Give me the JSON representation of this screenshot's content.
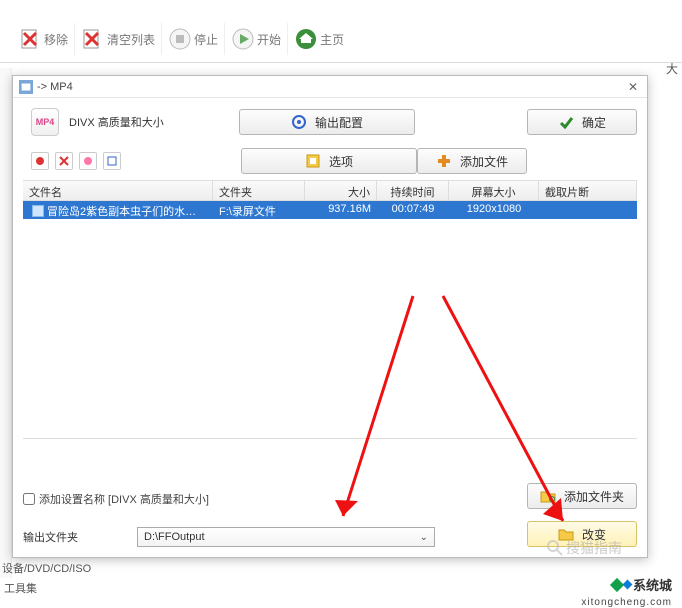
{
  "back_toolbar": {
    "remove": "移除",
    "clear": "清空列表",
    "stop": "停止",
    "start": "开始",
    "home": "主页"
  },
  "top_right_char": "大",
  "dialog": {
    "title": " -> MP4",
    "profile_label": "DIVX 高质量和大小",
    "btn_output": "输出配置",
    "btn_confirm": "确定",
    "btn_options": "选项",
    "btn_addfile": "添加文件"
  },
  "columns": {
    "name": "文件名",
    "folder": "文件夹",
    "size": "大小",
    "duration": "持续时间",
    "screen": "屏幕大小",
    "clip": "截取片断"
  },
  "rows": [
    {
      "name": "冒险岛2紫色副本虫子们的水上乐园水…",
      "folder": "F:\\录屏文件",
      "size": "937.16M",
      "duration": "00:07:49",
      "screen": "1920x1080",
      "clip": ""
    }
  ],
  "bottom": {
    "checkbox_label": "添加设置名称 [DIVX 高质量和大小]",
    "output_label": "输出文件夹",
    "output_value": "D:\\FFOutput",
    "btn_addfolder": "添加文件夹",
    "btn_change": "改变"
  },
  "underlying": {
    "devices_line": "设备/DVD/CD/ISO",
    "toolbox": "工具集"
  },
  "watermark": {
    "brand": "系统城",
    "sub": "xitongcheng.com",
    "search_hint": "搜猫指南"
  }
}
